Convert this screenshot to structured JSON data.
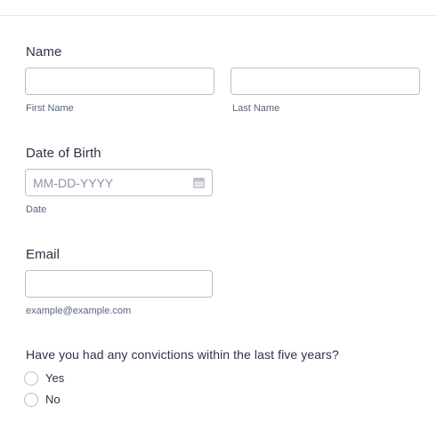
{
  "name_field": {
    "label": "Name",
    "first_name": {
      "value": "",
      "sublabel": "First Name"
    },
    "last_name": {
      "value": "",
      "sublabel": "Last Name"
    }
  },
  "dob_field": {
    "label": "Date of Birth",
    "placeholder": "MM-DD-YYYY",
    "sublabel": "Date",
    "icon": "calendar-icon"
  },
  "email_field": {
    "label": "Email",
    "value": "",
    "sublabel": "example@example.com"
  },
  "convictions_field": {
    "question": "Have you had any convictions within the last five years?",
    "options": [
      {
        "label": "Yes",
        "checked": false
      },
      {
        "label": "No",
        "checked": false
      }
    ]
  },
  "colors": {
    "text": "#2c3345",
    "sublabel": "#57647e",
    "border": "#b8bdc9",
    "placeholder": "#8d94a6"
  }
}
